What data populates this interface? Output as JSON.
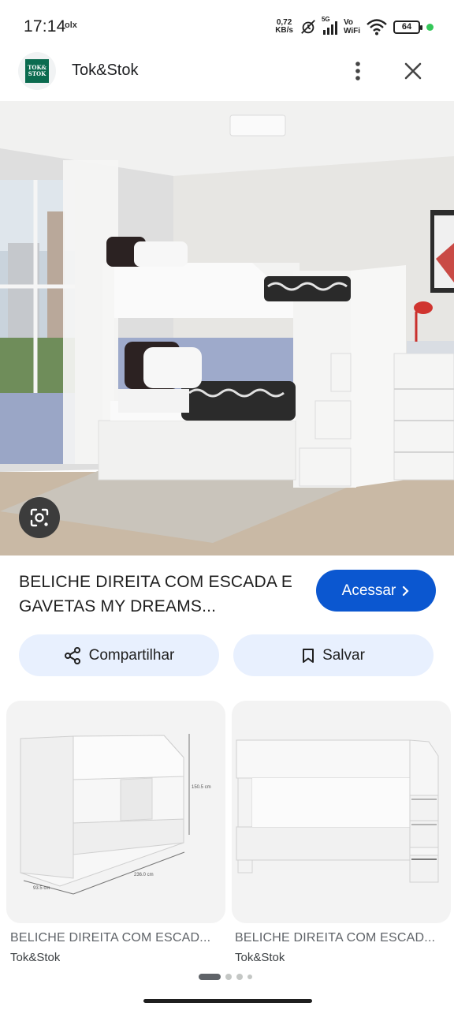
{
  "status_bar": {
    "time": "17:14",
    "notification": "olx",
    "net_speed_value": "0,72",
    "net_speed_unit": "KB/s",
    "network": "5G",
    "vowifi_line1": "Vo",
    "vowifi_line2": "WiFi",
    "battery": "64"
  },
  "header": {
    "site_name": "Tok&Stok",
    "logo_text_1": "TOK&",
    "logo_text_2": "STOK"
  },
  "product": {
    "title": "BELICHE DIREITA COM ESCADA E GAVETAS MY DREAMS...",
    "visit_label": "Acessar",
    "share_label": "Compartilhar",
    "save_label": "Salvar"
  },
  "related": [
    {
      "title": "BELICHE DIREITA COM ESCAD...",
      "source": "Tok&Stok",
      "dim_height": "150.5 cm",
      "dim_width": "236.0 cm",
      "dim_depth": "93.5 cm"
    },
    {
      "title": "BELICHE DIREITA COM ESCAD...",
      "source": "Tok&Stok"
    }
  ],
  "pager": {
    "pages": 4,
    "active": 0
  },
  "colors": {
    "accent": "#0b57d0",
    "tonal_button": "#e8f0fe",
    "logo_green": "#0b6b4f"
  },
  "icons": [
    "share-icon",
    "bookmark-icon",
    "chevron-right-icon",
    "more-vert-icon",
    "close-icon",
    "lens-icon"
  ]
}
